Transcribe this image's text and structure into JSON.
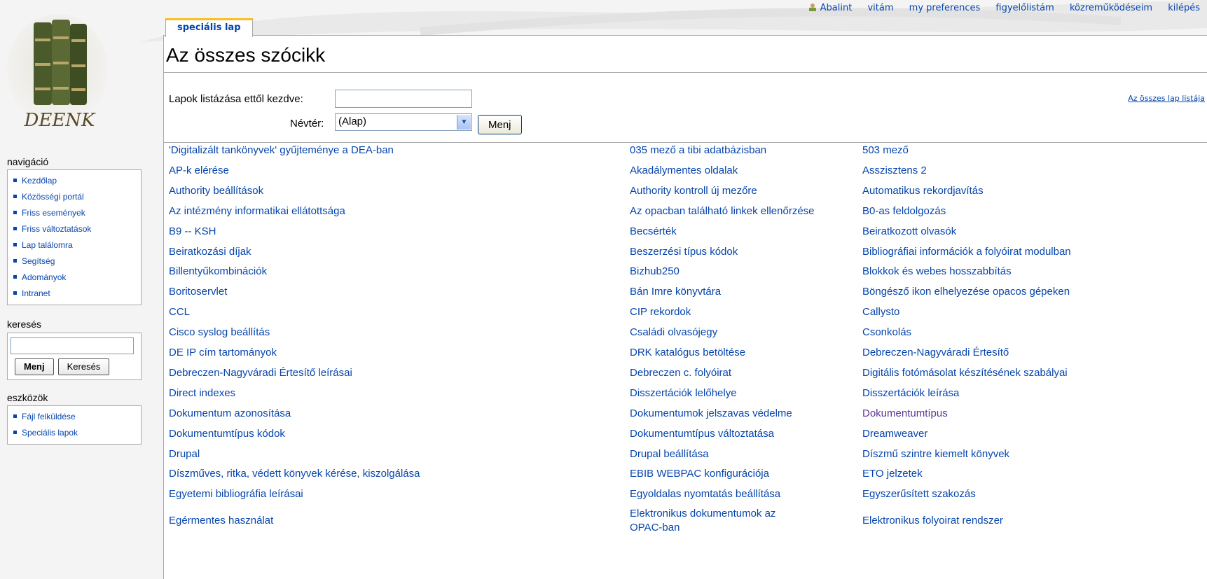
{
  "personal_bar": {
    "user": "Abalint",
    "talk": "vitám",
    "preferences": "my preferences",
    "watchlist": "figyelőlistám",
    "contributions": "közreműködéseim",
    "logout": "kilépés"
  },
  "logo": {
    "text": "DEENK"
  },
  "tab": {
    "label": "speciális lap"
  },
  "page": {
    "title": "Az összes szócikk",
    "from_label": "Lapok listázása ettől kezdve:",
    "from_value": "",
    "namespace_label": "Névtér:",
    "namespace_value": "(Alap)",
    "go_button": "Menj",
    "all_pages_link": "Az összes lap listája"
  },
  "sidebar": {
    "navigation": {
      "title": "navigáció",
      "items": [
        "Kezdőlap",
        "Közösségi portál",
        "Friss események",
        "Friss változtatások",
        "Lap találomra",
        "Segítség",
        "Adományok",
        "Intranet"
      ]
    },
    "search": {
      "title": "keresés",
      "go_button": "Menj",
      "search_button": "Keresés"
    },
    "toolbox": {
      "title": "eszközök",
      "items": [
        "Fájl felküldése",
        "Speciális lapok"
      ]
    }
  },
  "articles": {
    "col1": [
      "'Digitalizált tankönyvek' gyűjteménye a DEA-ban",
      "AP-k elérése",
      "Authority beállítások",
      "Az intézmény informatikai ellátottsága",
      "B9 -- KSH",
      "Beiratkozási díjak",
      "Billentyűkombinációk",
      "Boritoservlet",
      "CCL",
      "Cisco syslog beállítás",
      "DE IP cím tartományok",
      "Debreczen-Nagyváradi Értesítő leírásai",
      "Direct indexes",
      "Dokumentum azonosítása",
      "Dokumentumtípus kódok",
      "Drupal",
      "Díszműves, ritka, védett könyvek kérése, kiszolgálása",
      "Egyetemi bibliográfia leírásai",
      "Egérmentes használat"
    ],
    "col2": [
      "035 mező a tibi adatbázisban",
      "Akadálymentes oldalak",
      "Authority kontroll új mezőre",
      "Az opacban található linkek ellenőrzése",
      "Becsérték",
      "Beszerzési típus kódok",
      "Bizhub250",
      "Bán Imre könyvtára",
      "CIP rekordok",
      "Családi olvasójegy",
      "DRK katalógus betöltése",
      "Debreczen c. folyóirat",
      "Disszertációk lelőhelye",
      "Dokumentumok jelszavas védelme",
      "Dokumentumtípus változtatása",
      "Drupal beállítása",
      "EBIB WEBPAC konfigurációja",
      "Egyoldalas nyomtatás beállítása"
    ],
    "col2_last_line1": "Elektronikus dokumentumok az",
    "col2_last_line2": "OPAC-ban",
    "col3": [
      "503 mező",
      "Asszisztens 2",
      "Automatikus rekordjavítás",
      "B0-as feldolgozás",
      "Beiratkozott olvasók",
      "Bibliográfiai információk a folyóirat modulban",
      "Blokkok és webes hosszabbítás",
      "Böngésző ikon elhelyezése opacos gépeken",
      "Callysto",
      "Csonkolás",
      "Debreczen-Nagyváradi Értesítő",
      "Digitális fotómásolat készítésének szabályai",
      "Disszertációk leírása",
      "Dokumentumtípus",
      "Dreamweaver",
      "Díszmű szintre kiemelt könyvek",
      "ETO jelzetek",
      "Egyszerűsített szakozás",
      "Elektronikus folyoirat rendszer"
    ]
  },
  "colors": {
    "link": "#0645ad",
    "visited": "#5a3696",
    "tab_accent": "#fabd23"
  }
}
